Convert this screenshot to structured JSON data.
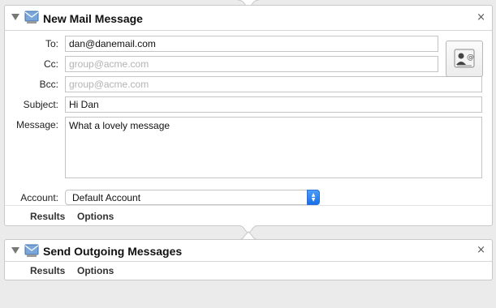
{
  "actions": [
    {
      "title": "New Mail Message",
      "close_glyph": "×",
      "icon": "mail-app-icon",
      "fields": {
        "to": {
          "label": "To:",
          "value": "dan@danemail.com",
          "placeholder": ""
        },
        "cc": {
          "label": "Cc:",
          "value": "",
          "placeholder": "group@acme.com"
        },
        "bcc": {
          "label": "Bcc:",
          "value": "",
          "placeholder": "group@acme.com"
        },
        "subject": {
          "label": "Subject:",
          "value": "Hi Dan",
          "placeholder": ""
        },
        "message": {
          "label": "Message:",
          "value": "What a lovely message",
          "placeholder": ""
        },
        "account": {
          "label": "Account:",
          "value": "Default Account"
        }
      },
      "address_book_icon": "address-book-icon",
      "footer": {
        "results": "Results",
        "options": "Options"
      }
    },
    {
      "title": "Send Outgoing Messages",
      "close_glyph": "×",
      "icon": "mail-app-icon",
      "footer": {
        "results": "Results",
        "options": "Options"
      }
    }
  ],
  "colors": {
    "stepper_blue": "#1a6fe6",
    "panel_bg": "#ffffff",
    "window_bg": "#ebebeb"
  }
}
